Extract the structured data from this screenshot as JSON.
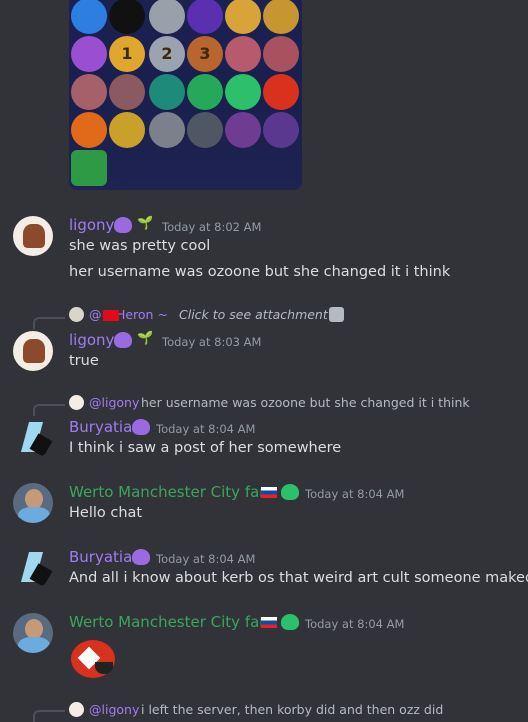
{
  "attachment": {
    "trophy_numbers": [
      "1",
      "2",
      "3"
    ]
  },
  "messages": [
    {
      "author": "ligony",
      "author_color": "#a17bf5",
      "timestamp": "Today at 8:02 AM",
      "lines": [
        "she was pretty cool",
        "her username was ozoone but she changed it i think"
      ]
    },
    {
      "reply": {
        "author": "@​~ Heron ~",
        "text": "Click to see attachment",
        "icon": "image-icon"
      },
      "author": "ligony",
      "author_color": "#a17bf5",
      "timestamp": "Today at 8:03 AM",
      "lines": [
        "true"
      ]
    },
    {
      "reply": {
        "author": "@ligony",
        "text": "her username was ozoone but she changed it i think"
      },
      "author": "Buryatia",
      "author_color": "#a17bf5",
      "timestamp": "Today at 8:04 AM",
      "lines": [
        "I think i saw a post of her somewhere"
      ]
    },
    {
      "author": "Werto Manchester City fan",
      "author_color": "#3ba55d",
      "timestamp": "Today at 8:04 AM",
      "lines": [
        "Hello chat"
      ]
    },
    {
      "author": "Buryatia",
      "author_color": "#a17bf5",
      "timestamp": "Today at 8:04 AM",
      "lines": [
        "And all i know about kerb os that weird art cult someone maked"
      ]
    },
    {
      "author": "Werto Manchester City fan",
      "author_color": "#3ba55d",
      "timestamp": "Today at 8:04 AM",
      "lines": []
    },
    {
      "reply": {
        "author": "@ligony",
        "text": "i left the server, then korby did and then ozz did"
      }
    }
  ],
  "colors": {
    "background": "#313338",
    "text": "#dbdee1",
    "muted": "#949ba4",
    "purple_name": "#a17bf5",
    "green_name": "#3ba55d"
  }
}
